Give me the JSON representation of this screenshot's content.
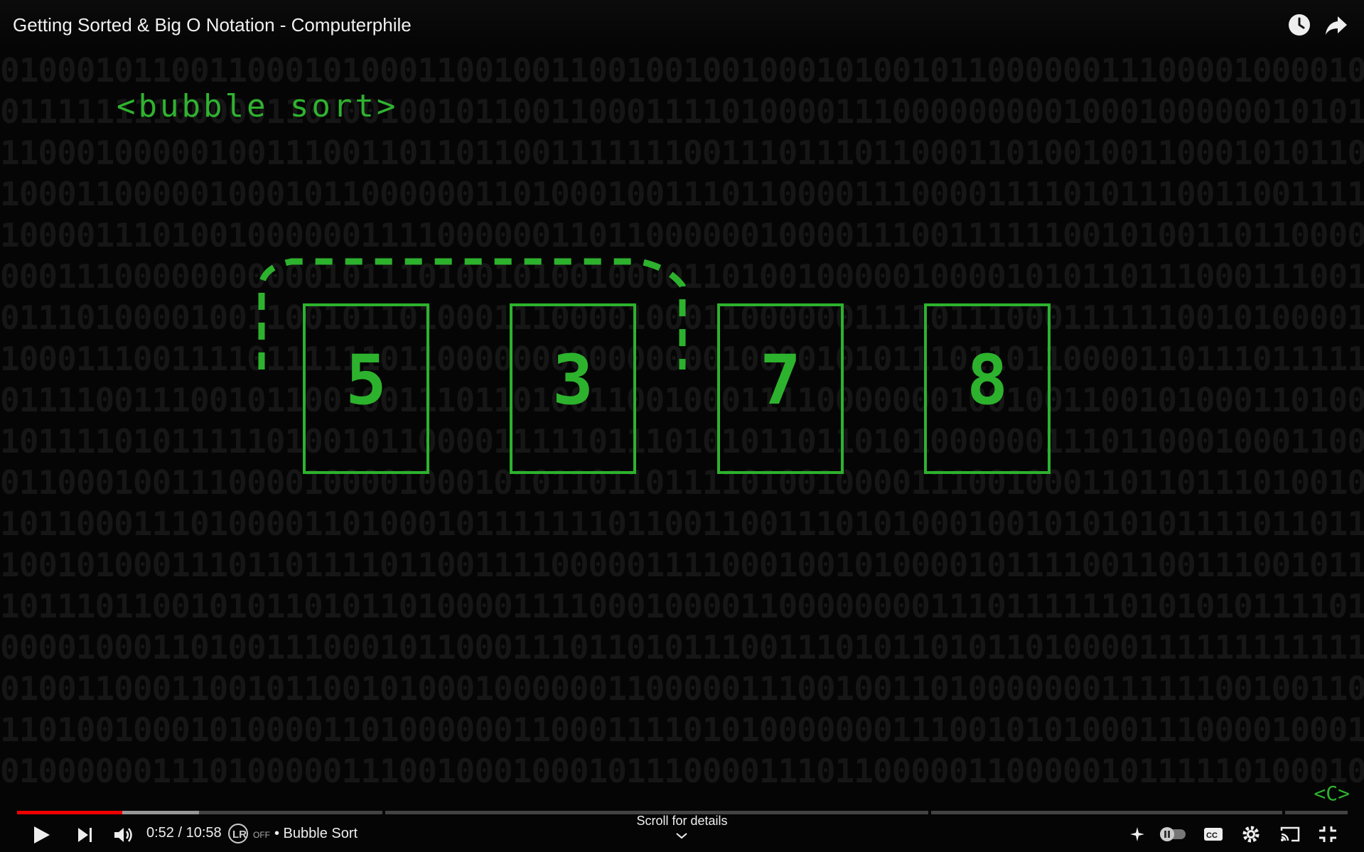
{
  "video": {
    "title": "Getting Sorted & Big O Notation - Computerphile",
    "watch_later_icon": "clock-icon",
    "share_icon": "share-arrow-icon"
  },
  "scene": {
    "heading": "<bubble sort>",
    "cards": [
      "5",
      "3",
      "7",
      "8"
    ],
    "channel_logo": "<C>",
    "colors": {
      "accent": "#2db22d",
      "binary": "#161616"
    }
  },
  "player": {
    "current_time": "0:52",
    "duration": "10:58",
    "time_display": "0:52 / 10:58",
    "progress_fraction": 0.079,
    "buffered_fraction": 0.137,
    "autoplay_badge": "OFF",
    "chapter": "• Bubble Sort",
    "scroll_hint": "Scroll for details",
    "play_color": "#ff0000"
  }
}
